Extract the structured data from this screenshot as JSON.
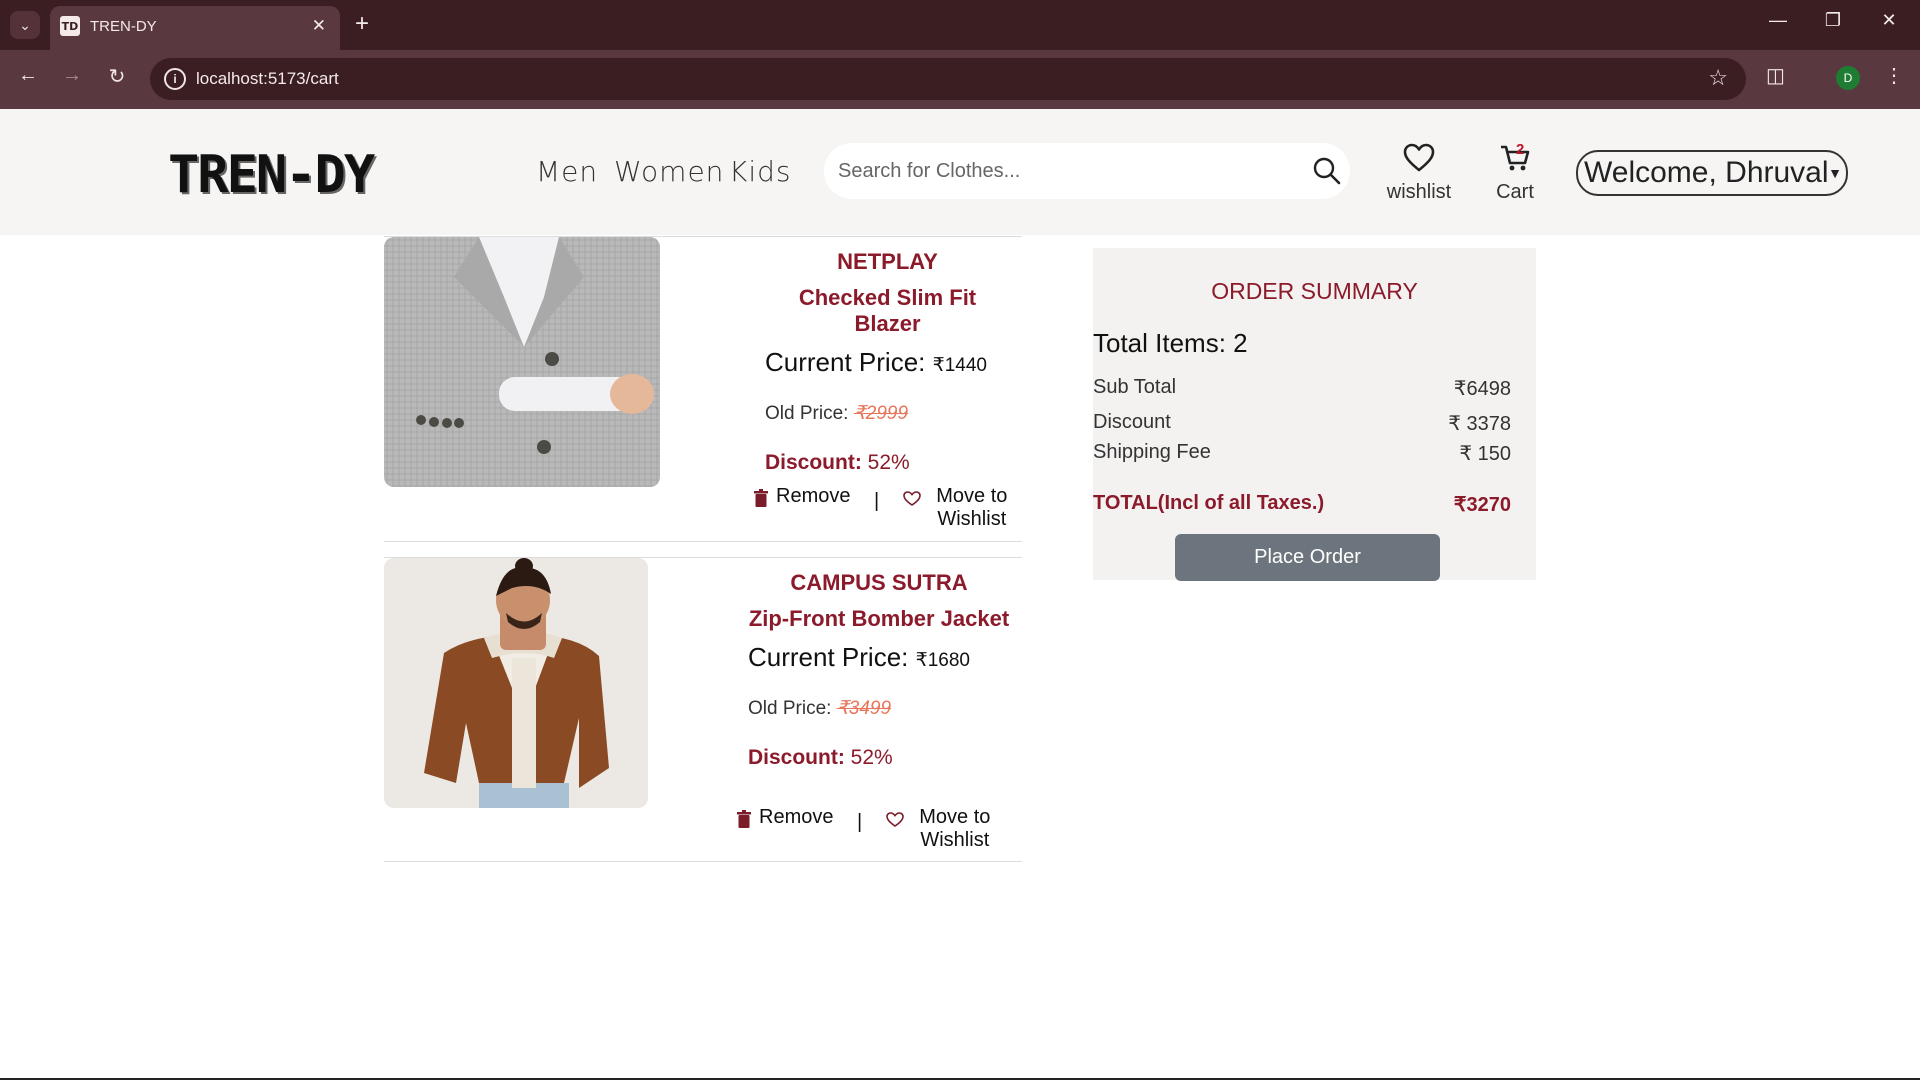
{
  "browser": {
    "tab_title": "TREN-DY",
    "tab_favicon": "TD",
    "url": "localhost:5173/cart",
    "profile_initial": "D",
    "icons": [
      "tab-search-icon",
      "close-icon",
      "plus-icon",
      "minimize-icon",
      "restore-icon",
      "back-icon",
      "forward-icon",
      "reload-icon",
      "site-info-icon",
      "star-icon",
      "extensions-icon",
      "kebab-menu-icon"
    ]
  },
  "header": {
    "logo": "TREN-DY",
    "nav": [
      "Men",
      "Women",
      "Kids"
    ],
    "search_placeholder": "Search for Clothes...",
    "wishlist_label": "wishlist",
    "cart_label": "Cart",
    "cart_count": "2",
    "user_greeting": "Welcome, Dhruval"
  },
  "cart": {
    "items": [
      {
        "brand": "NETPLAY",
        "name": "Checked Slim Fit Blazer",
        "current_label": "Current Price:",
        "current_price": "₹1440",
        "old_label": "Old Price:",
        "old_price": "₹2999",
        "discount_label": "Discount:",
        "discount": "52%",
        "remove_label": "Remove",
        "wishlist_label": "Move to Wishlist",
        "image": "grey-checked-blazer"
      },
      {
        "brand": "CAMPUS SUTRA",
        "name": "Zip-Front Bomber Jacket",
        "current_label": "Current Price:",
        "current_price": "₹1680",
        "old_label": "Old Price:",
        "old_price": "₹3499",
        "discount_label": "Discount:",
        "discount": "52%",
        "remove_label": "Remove",
        "wishlist_label": "Move to Wishlist",
        "image": "brown-bomber-jacket"
      }
    ],
    "separator": "|"
  },
  "summary": {
    "title": "ORDER SUMMARY",
    "total_items": "Total Items: 2",
    "subtotal_label": "Sub Total",
    "subtotal": "₹6498",
    "discount_label": "Discount",
    "discount": "₹ 3378",
    "shipping_label": "Shipping Fee",
    "shipping": "₹ 150",
    "total_label": "TOTAL(Incl of all Taxes.)",
    "total": "₹3270",
    "place_order": "Place Order"
  },
  "colors": {
    "accent": "#8b1a2b",
    "strike": "#e8765b",
    "chrome_dark": "#3b1e22",
    "chrome_mid": "#5a3840",
    "button": "#6c757d"
  }
}
